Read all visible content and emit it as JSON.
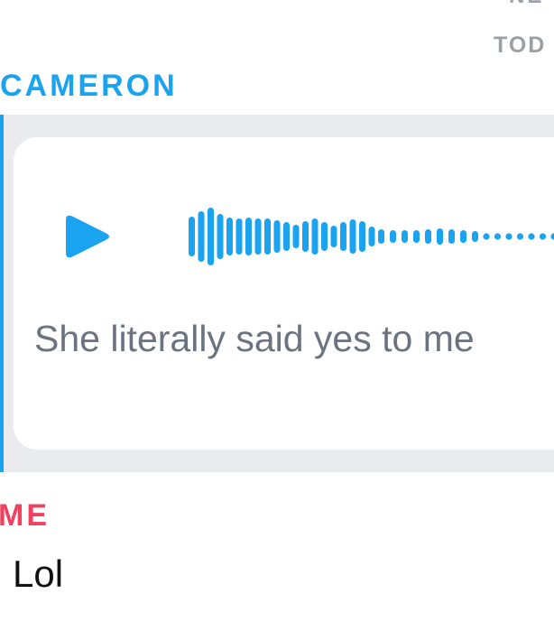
{
  "header": {
    "new_label_partial": "NE",
    "date_divider": "TOD"
  },
  "messages": [
    {
      "sender": "CAMERON",
      "sender_color": "#1aa3f0",
      "type": "voice-note",
      "play_icon": "play-icon",
      "waveform_icon": "audio-waveform-icon",
      "transcript": "She literally said yes to me"
    },
    {
      "sender": "ME",
      "sender_color": "#f0425f",
      "type": "text",
      "text": "Lol"
    }
  ],
  "colors": {
    "accent_blue": "#1aa3f0",
    "accent_red": "#f0425f",
    "muted_gray": "#9aa0a6",
    "message_bg": "#e9ebee"
  }
}
